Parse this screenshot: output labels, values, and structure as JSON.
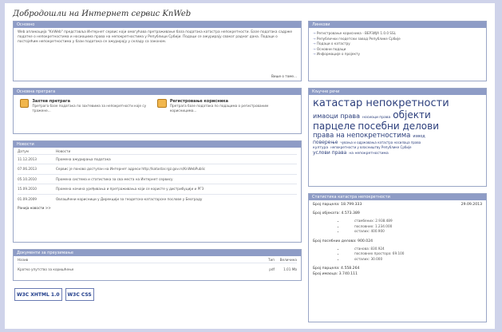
{
  "title": "Добродошли на Интернет сервис KnWeb",
  "about": {
    "header": "Основно",
    "text": "Web апликација \"KnWeb\" представља Интернет сервис који омогућава претраживање база података катастра непокретности. Базе података садрже податке о непокретностима и носиоцима права на непокретностима у Републици Србији. Подаци се ажурирају сваког радног дана. Подаци о постојећим непокретностима у бази података се ажурирају у складу са законом.",
    "more": "Више о томе..."
  },
  "search": {
    "header": "Основна претрага",
    "items": [
      {
        "title": "Захтев претрага",
        "desc": "Претрага базе података по захтевима за непокретности које су тражене..."
      },
      {
        "title": "Регистровање корисника",
        "desc": "Претрага базе података по подацима о регистрованим корисницима..."
      }
    ]
  },
  "news": {
    "header": "Новости",
    "col_date": "Датум",
    "col_news": "Новости",
    "rows": [
      {
        "date": "11.12.2013",
        "text": "Промена ажурирања података"
      },
      {
        "date": "07.06.2013",
        "text": "Сервис је поново доступан на Интернет адреси http://katastar.rgz.gov.rs/KnWebPublic"
      },
      {
        "date": "05.10.2010",
        "text": "Промена система и статистика за сва места на Интернет сервису"
      },
      {
        "date": "15.09.2010",
        "text": "Промена начина уређивања и претраживања који се користе у дистрибуцији и РГЗ"
      },
      {
        "date": "01.09.2009",
        "text": "Овлашћени корисници у Дирекцији за геодетско-катастарске послове у Београду"
      }
    ],
    "more": "Ранија новости >>"
  },
  "docs": {
    "header": "Документи за преузимање",
    "col_name": "Назив",
    "col_type": "Тип",
    "col_size": "Величина",
    "rows": [
      {
        "name": "Кратко упутство за коришћење",
        "type": "pdf",
        "size": "1.01 Mb"
      }
    ]
  },
  "badges": [
    "W3C XHTML 1.0",
    "W3C CSS"
  ],
  "links": {
    "header": "Линкови",
    "items": [
      "Регистровање корисника - ВЕРЗИЈА 1.0.0 SSL",
      "Републички геодетски завод Републике Србије",
      "Подаци о катастру",
      "Основни подаци",
      "Информације о пројекту"
    ]
  },
  "keywords": {
    "header": "Кључне речи",
    "lines": [
      [
        {
          "text": "катастар непокретности",
          "size": 13
        }
      ],
      [
        {
          "text": "имаоци права",
          "size": 8
        },
        {
          "text": "носиоци права",
          "size": 4.5
        },
        {
          "text": "објекти",
          "size": 12
        }
      ],
      [
        {
          "text": "парцеле",
          "size": 12
        },
        {
          "text": "посебни делови",
          "size": 12
        }
      ],
      [
        {
          "text": "права на непокретностима",
          "size": 8.5
        },
        {
          "text": "извод",
          "size": 5
        }
      ],
      [
        {
          "text": "поверење",
          "size": 6
        },
        {
          "text": "чувања и одржавања катастра носилаца права",
          "size": 4
        }
      ],
      [
        {
          "text": "култура",
          "size": 4.5
        },
        {
          "text": "непокретности у власништву Републике Србије",
          "size": 4
        }
      ],
      [
        {
          "text": "услови права",
          "size": 6
        },
        {
          "text": "на непокретностима",
          "size": 4.5
        }
      ]
    ]
  },
  "stats": {
    "header": "Статистика катастра непокретности",
    "parcels_label": "Број парцела: 18.799.333",
    "parcels_date": "29.09.2013",
    "objects_label": "Број објеката: 4.573.389",
    "objects_items": [
      "стамбених: 2.938.489",
      "пословних: 1.234.000",
      "осталих: 400.900"
    ],
    "units_label": "Број посебних делова: 900.024",
    "units_items": [
      "станова: 830.924",
      "пословних простора: 69.100",
      "осталих: 30.000"
    ],
    "holders_label": "Број парцела: 4.558.264",
    "rights_label": "Број имаоца: 3.740.111"
  }
}
